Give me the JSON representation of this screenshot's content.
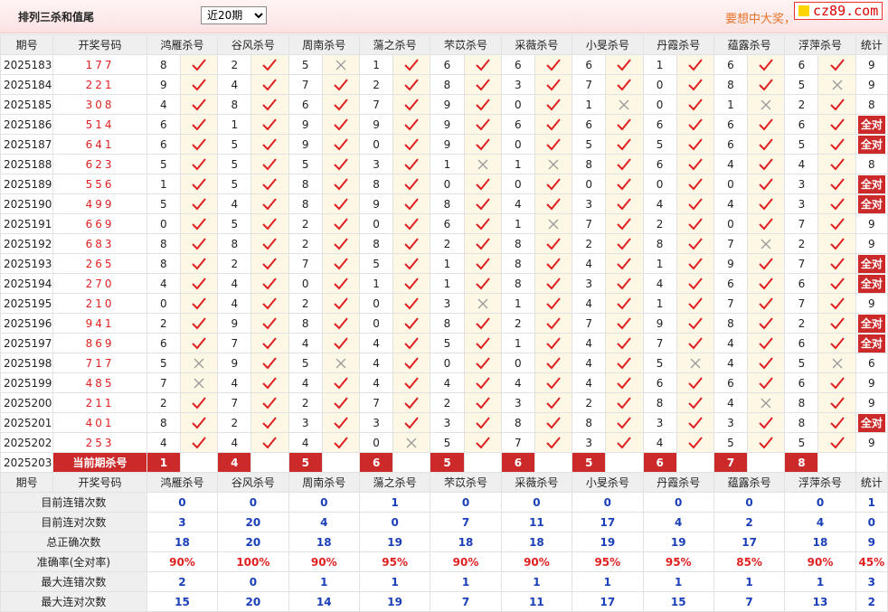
{
  "header": {
    "title": "排列三杀和值尾",
    "period_select": {
      "selected": "近20期",
      "options": [
        "近20期"
      ]
    },
    "promo_text": "要想中大奖，",
    "logo_text": "cz89.com"
  },
  "columns": {
    "period": "期号",
    "number": "开奖号码",
    "experts": [
      "鸿雁杀号",
      "谷风杀号",
      "周南杀号",
      "蕩之杀号",
      "芣苡杀号",
      "采薇杀号",
      "小旻杀号",
      "丹霞杀号",
      "蕴露杀号",
      "浮萍杀号"
    ],
    "count": "统计"
  },
  "all_right_label": "全对",
  "rows": [
    {
      "period": "2025183",
      "number": "177",
      "kills": [
        8,
        2,
        5,
        1,
        6,
        6,
        6,
        1,
        6,
        6
      ],
      "marks": [
        1,
        1,
        0,
        1,
        1,
        1,
        1,
        1,
        1,
        1
      ],
      "count": "9"
    },
    {
      "period": "2025184",
      "number": "221",
      "kills": [
        9,
        4,
        7,
        2,
        8,
        3,
        7,
        0,
        8,
        5
      ],
      "marks": [
        1,
        1,
        1,
        1,
        1,
        1,
        1,
        1,
        1,
        0
      ],
      "count": "9"
    },
    {
      "period": "2025185",
      "number": "308",
      "kills": [
        4,
        8,
        6,
        7,
        9,
        0,
        1,
        0,
        1,
        2
      ],
      "marks": [
        1,
        1,
        1,
        1,
        1,
        1,
        0,
        1,
        0,
        1
      ],
      "count": "8"
    },
    {
      "period": "2025186",
      "number": "514",
      "kills": [
        6,
        1,
        9,
        9,
        9,
        6,
        6,
        6,
        6,
        6
      ],
      "marks": [
        1,
        1,
        1,
        1,
        1,
        1,
        1,
        1,
        1,
        1
      ],
      "count": "全对"
    },
    {
      "period": "2025187",
      "number": "641",
      "kills": [
        6,
        5,
        9,
        0,
        9,
        0,
        5,
        5,
        6,
        5
      ],
      "marks": [
        1,
        1,
        1,
        1,
        1,
        1,
        1,
        1,
        1,
        1
      ],
      "count": "全对"
    },
    {
      "period": "2025188",
      "number": "623",
      "kills": [
        5,
        5,
        5,
        3,
        1,
        1,
        8,
        6,
        4,
        4
      ],
      "marks": [
        1,
        1,
        1,
        1,
        0,
        0,
        1,
        1,
        1,
        1
      ],
      "count": "8"
    },
    {
      "period": "2025189",
      "number": "556",
      "kills": [
        1,
        5,
        8,
        8,
        0,
        0,
        0,
        0,
        0,
        3
      ],
      "marks": [
        1,
        1,
        1,
        1,
        1,
        1,
        1,
        1,
        1,
        1
      ],
      "count": "全对"
    },
    {
      "period": "2025190",
      "number": "499",
      "kills": [
        5,
        4,
        8,
        9,
        8,
        4,
        3,
        4,
        4,
        3
      ],
      "marks": [
        1,
        1,
        1,
        1,
        1,
        1,
        1,
        1,
        1,
        1
      ],
      "count": "全对"
    },
    {
      "period": "2025191",
      "number": "669",
      "kills": [
        0,
        5,
        2,
        0,
        6,
        1,
        7,
        2,
        0,
        7
      ],
      "marks": [
        1,
        1,
        1,
        1,
        1,
        0,
        1,
        1,
        1,
        1
      ],
      "count": "9"
    },
    {
      "period": "2025192",
      "number": "683",
      "kills": [
        8,
        8,
        2,
        8,
        2,
        8,
        2,
        8,
        7,
        2
      ],
      "marks": [
        1,
        1,
        1,
        1,
        1,
        1,
        1,
        1,
        0,
        1
      ],
      "count": "9"
    },
    {
      "period": "2025193",
      "number": "265",
      "kills": [
        8,
        2,
        7,
        5,
        1,
        8,
        4,
        1,
        9,
        7
      ],
      "marks": [
        1,
        1,
        1,
        1,
        1,
        1,
        1,
        1,
        1,
        1
      ],
      "count": "全对"
    },
    {
      "period": "2025194",
      "number": "270",
      "kills": [
        4,
        4,
        0,
        1,
        1,
        8,
        3,
        4,
        6,
        6
      ],
      "marks": [
        1,
        1,
        1,
        1,
        1,
        1,
        1,
        1,
        1,
        1
      ],
      "count": "全对"
    },
    {
      "period": "2025195",
      "number": "210",
      "kills": [
        0,
        4,
        2,
        0,
        3,
        1,
        4,
        1,
        7,
        7
      ],
      "marks": [
        1,
        1,
        1,
        1,
        0,
        1,
        1,
        1,
        1,
        1
      ],
      "count": "9"
    },
    {
      "period": "2025196",
      "number": "941",
      "kills": [
        2,
        9,
        8,
        0,
        8,
        2,
        7,
        9,
        8,
        2
      ],
      "marks": [
        1,
        1,
        1,
        1,
        1,
        1,
        1,
        1,
        1,
        1
      ],
      "count": "全对"
    },
    {
      "period": "2025197",
      "number": "869",
      "kills": [
        6,
        7,
        4,
        4,
        5,
        1,
        4,
        7,
        4,
        6
      ],
      "marks": [
        1,
        1,
        1,
        1,
        1,
        1,
        1,
        1,
        1,
        1
      ],
      "count": "全对"
    },
    {
      "period": "2025198",
      "number": "717",
      "kills": [
        5,
        9,
        5,
        4,
        0,
        0,
        4,
        5,
        4,
        5
      ],
      "marks": [
        0,
        1,
        0,
        1,
        1,
        1,
        1,
        0,
        1,
        0
      ],
      "count": "6"
    },
    {
      "period": "2025199",
      "number": "485",
      "kills": [
        7,
        4,
        4,
        4,
        4,
        4,
        4,
        6,
        6,
        6
      ],
      "marks": [
        0,
        1,
        1,
        1,
        1,
        1,
        1,
        1,
        1,
        1
      ],
      "count": "9"
    },
    {
      "period": "2025200",
      "number": "211",
      "kills": [
        2,
        7,
        2,
        7,
        2,
        3,
        2,
        8,
        4,
        8
      ],
      "marks": [
        1,
        1,
        1,
        1,
        1,
        1,
        1,
        1,
        0,
        1
      ],
      "count": "9"
    },
    {
      "period": "2025201",
      "number": "401",
      "kills": [
        8,
        2,
        3,
        3,
        3,
        8,
        8,
        3,
        3,
        8
      ],
      "marks": [
        1,
        1,
        1,
        1,
        1,
        1,
        1,
        1,
        1,
        1
      ],
      "count": "全对"
    },
    {
      "period": "2025202",
      "number": "253",
      "kills": [
        4,
        4,
        4,
        0,
        5,
        7,
        3,
        4,
        5,
        5
      ],
      "marks": [
        1,
        1,
        1,
        0,
        1,
        1,
        1,
        1,
        1,
        1
      ],
      "count": "9"
    }
  ],
  "current": {
    "period": "2025203",
    "label": "当前期杀号",
    "kills": [
      "1",
      "4",
      "5",
      "6",
      "5",
      "6",
      "5",
      "6",
      "7",
      "8"
    ]
  },
  "stats": [
    {
      "label": "目前连错次数",
      "values": [
        "0",
        "0",
        "0",
        "1",
        "0",
        "0",
        "0",
        "0",
        "0",
        "0"
      ],
      "count": "1",
      "kind": "num"
    },
    {
      "label": "目前连对次数",
      "values": [
        "3",
        "20",
        "4",
        "0",
        "7",
        "11",
        "17",
        "4",
        "2",
        "4"
      ],
      "count": "0",
      "kind": "num"
    },
    {
      "label": "总正确次数",
      "values": [
        "18",
        "20",
        "18",
        "19",
        "18",
        "18",
        "19",
        "19",
        "17",
        "18"
      ],
      "count": "9",
      "kind": "num"
    },
    {
      "label": "准确率(全对率)",
      "values": [
        "90%",
        "100%",
        "90%",
        "95%",
        "90%",
        "90%",
        "95%",
        "95%",
        "85%",
        "90%"
      ],
      "count": "45%",
      "kind": "rate"
    },
    {
      "label": "最大连错次数",
      "values": [
        "2",
        "0",
        "1",
        "1",
        "1",
        "1",
        "1",
        "1",
        "1",
        "1"
      ],
      "count": "3",
      "kind": "num"
    },
    {
      "label": "最大连对次数",
      "values": [
        "15",
        "20",
        "14",
        "19",
        "7",
        "11",
        "17",
        "15",
        "7",
        "13"
      ],
      "count": "2",
      "kind": "num"
    }
  ],
  "colors": {
    "accent_red": "#cc2a2a",
    "check_red": "#e02020",
    "cross_gray": "#9a9a9a",
    "mark_bg": "#fdf7e6",
    "stat_blue": "#1a3fb8",
    "promo_orange": "#e8742a"
  }
}
